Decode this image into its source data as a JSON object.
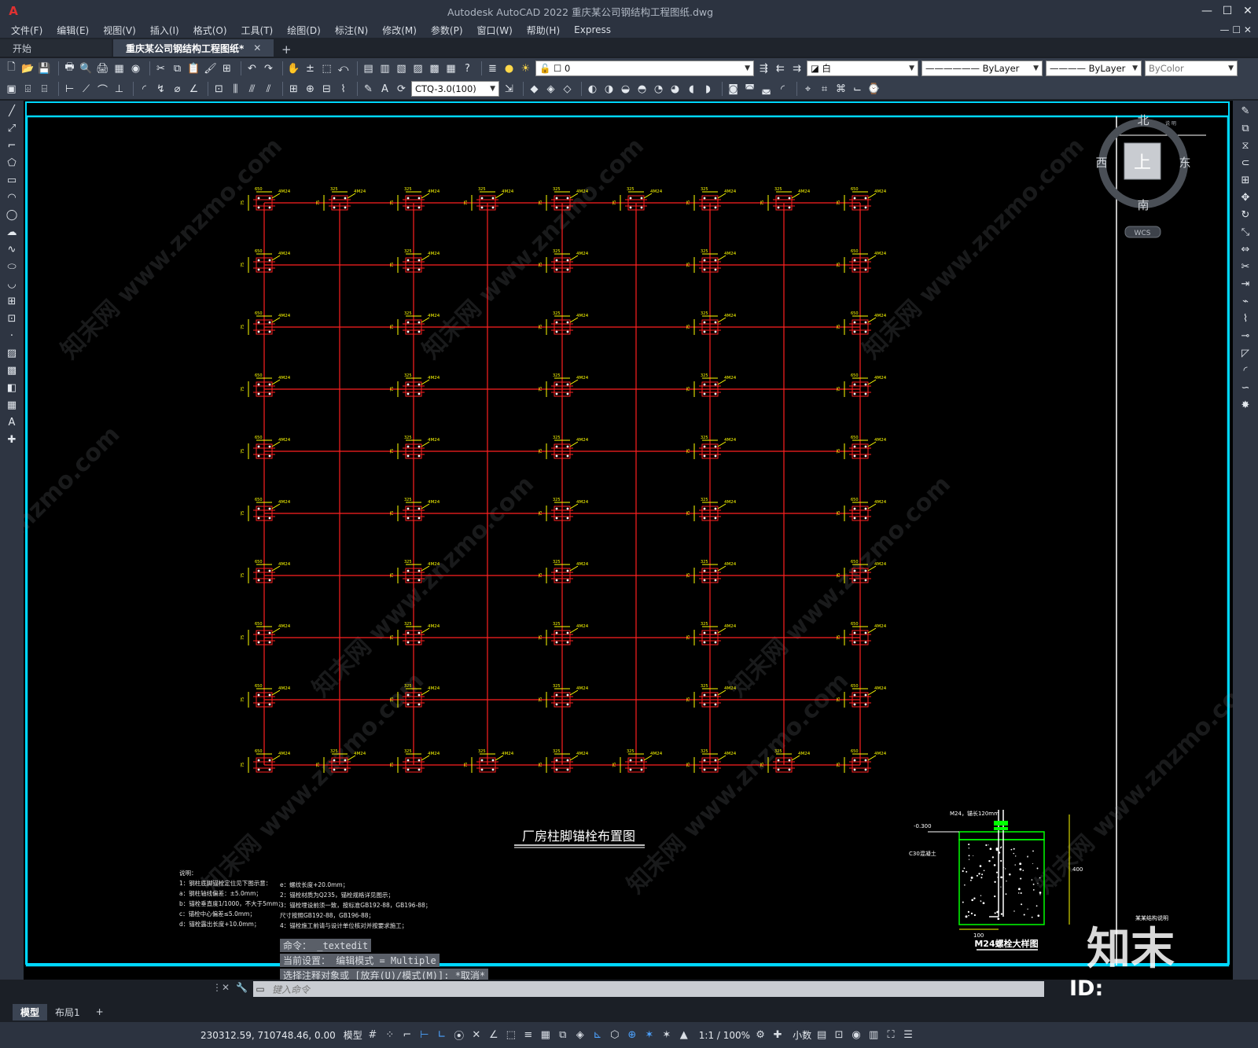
{
  "app": {
    "logo": "A",
    "window_title": "Autodesk AutoCAD 2022    重庆某公司钢结构工程图纸.dwg",
    "min_btn": "—",
    "max_btn": "☐",
    "close_btn": "✕"
  },
  "menu": [
    "文件(F)",
    "编辑(E)",
    "视图(V)",
    "插入(I)",
    "格式(O)",
    "工具(T)",
    "绘图(D)",
    "标注(N)",
    "修改(M)",
    "参数(P)",
    "窗口(W)",
    "帮助(H)",
    "Express"
  ],
  "menu_right_controls": "— ☐ ✕",
  "tabs": {
    "start": "开始",
    "doc": "重庆某公司钢结构工程图纸*",
    "close": "✕",
    "add": "+"
  },
  "toolbar": {
    "layer_value": "0",
    "color_value": "白",
    "linetype_value": "ByLayer",
    "lineweight_value": "ByLayer",
    "plotstyle_value": "ByColor",
    "dimstyle_value": "CTQ-3.0(100)"
  },
  "viewcube": {
    "north": "北",
    "south": "南",
    "east": "东",
    "west": "西",
    "top": "上",
    "wcs": "WCS",
    "small_caption": "说 明"
  },
  "drawing": {
    "main_title": "厂房柱脚锚栓布置图",
    "bolt_label": "4M24",
    "dim_650": "650",
    "dim_75": "75",
    "dim_325": "325",
    "detail_title": "M24螺栓大样图",
    "detail_notes": [
      "M24，锚长120mm",
      "-0.300",
      "C30混凝土",
      "100",
      "400"
    ],
    "side_label": "某某结构说明",
    "notes_title": "说明：",
    "notes_left": [
      "1：钢柱底脚锚栓定位见下图示意：",
      "a：钢柱轴线偏差：±5.0mm；",
      "b：锚栓垂直度1/1000，不大于5mm；",
      "c：锚栓中心偏差≤5.0mm；",
      "d：锚栓露出长度+10.0mm；"
    ],
    "notes_right": [
      "e：螺纹长度+20.0mm；",
      "2：锚栓材质为Q235，锚栓规格详见图示；",
      "3：锚栓埋设前须一致，按标准GB192-88，GB196-88；",
      "尺寸按照GB192-88，GB196-88；",
      "4：锚栓施工前请与设计单位核对并按要求施工；"
    ]
  },
  "watermark": {
    "brand": "知末",
    "id_text": "ID: 1175377077",
    "site": "znzmo.com",
    "cn": "知末网 www.znzmo.com"
  },
  "command": {
    "history": [
      "命令： _textedit",
      "当前设置： 编辑模式 = Multiple",
      "选择注释对象或 [放弃(U)/模式(M)]: *取消*"
    ],
    "placeholder": "键入命令"
  },
  "status": {
    "layout_tabs": [
      "模型",
      "布局1"
    ],
    "add_layout": "+",
    "coords": "230312.59, 710748.46, 0.00",
    "model_label": "模型",
    "scale": "1:1 / 100%",
    "units": "小数"
  },
  "colors": {
    "grid_red": "#ff2020",
    "anno_yellow": "#ffff00",
    "frame_cyan": "#00d8ff",
    "detail_green": "#00ff00"
  }
}
